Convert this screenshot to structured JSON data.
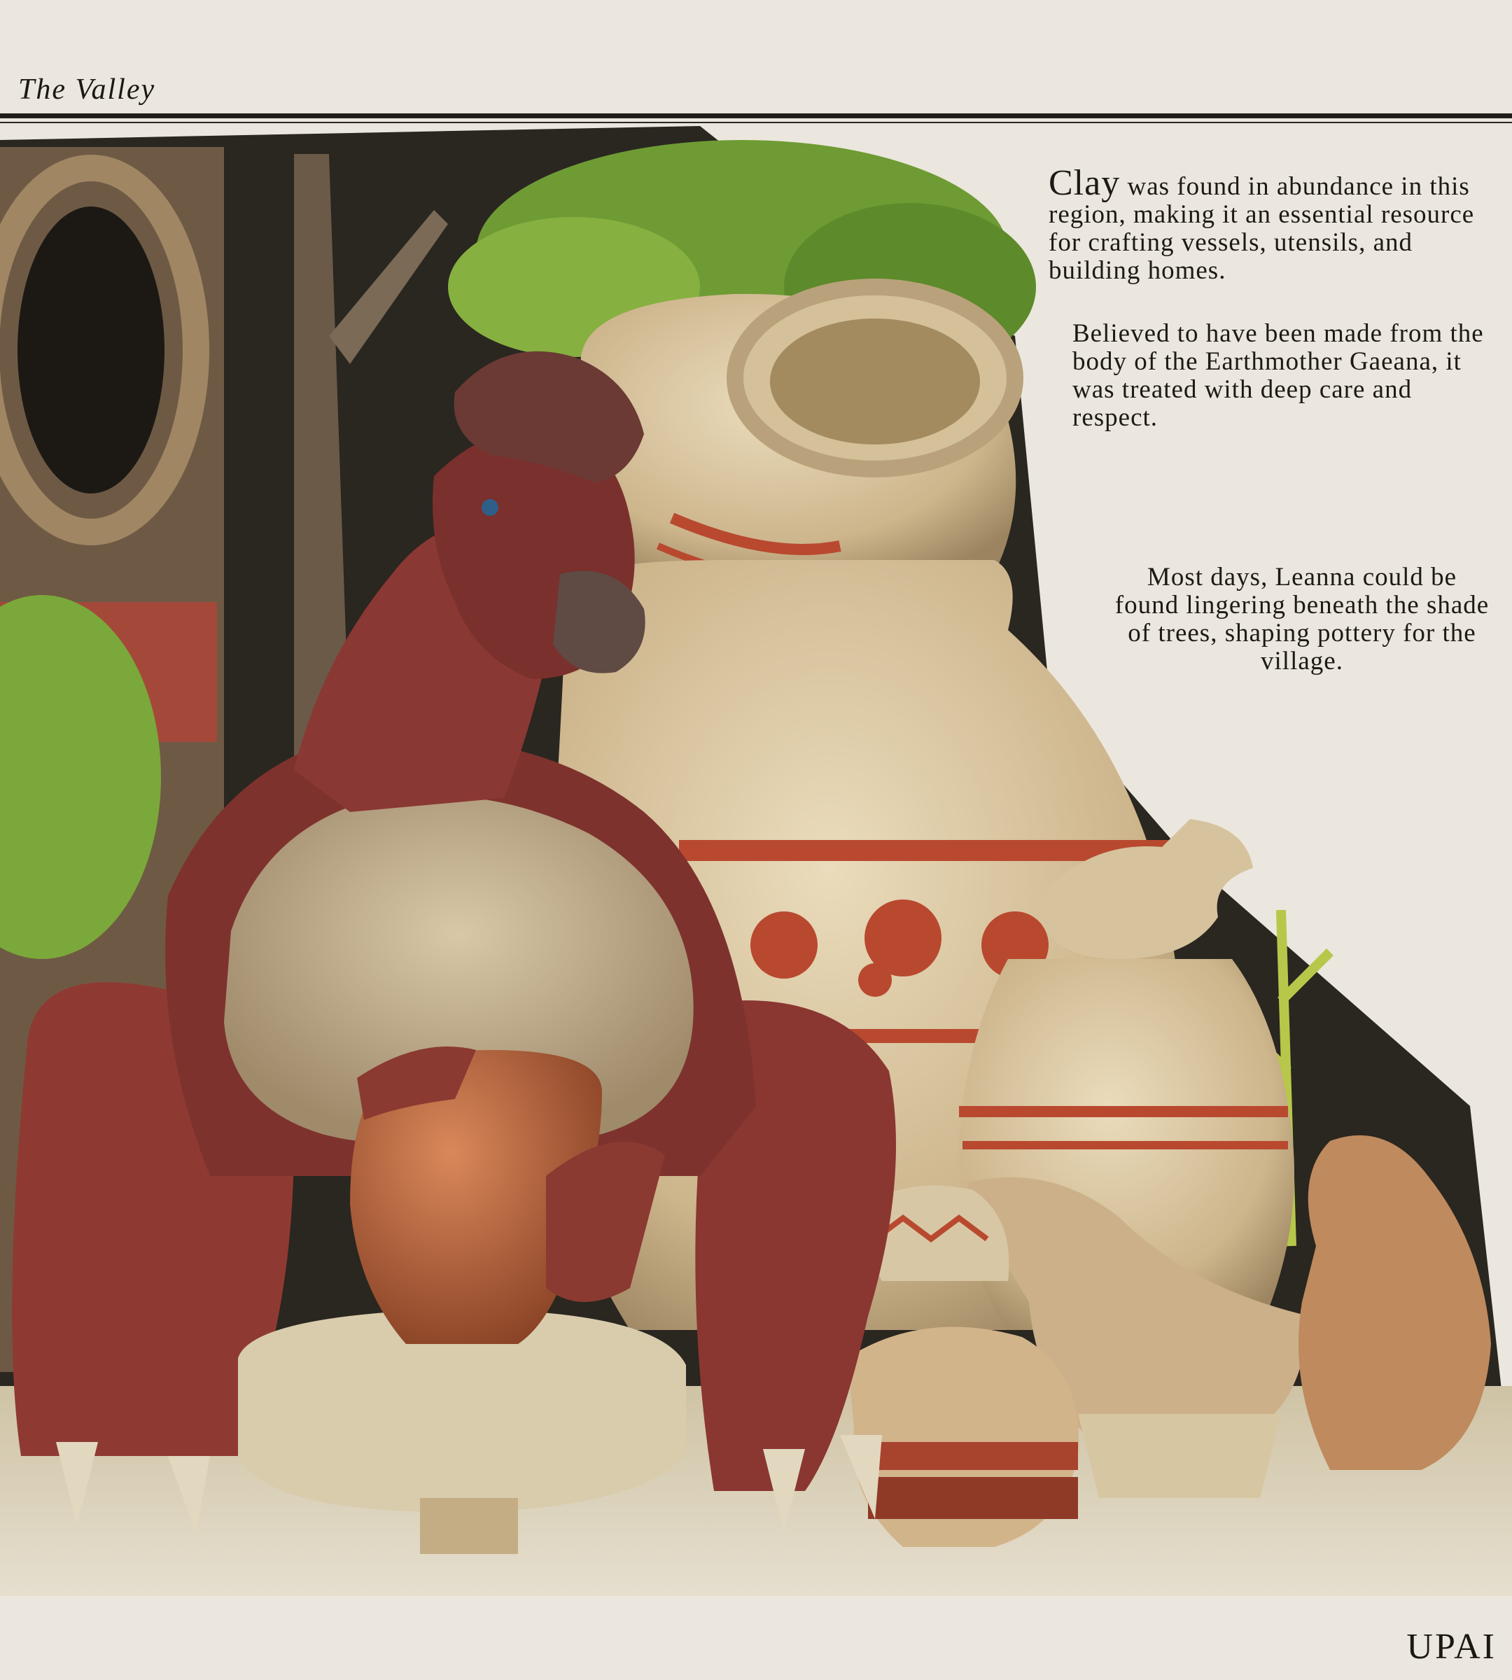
{
  "header": {
    "title": "The Valley"
  },
  "text": {
    "para1_lead": "Clay",
    "para1_rest": " was found in abundance in this region, making it an essential resource for crafting vessels, utensils, and building homes.",
    "para2": "Believed to have been made from the body of the Earthmother Gaeana, it was treated with deep care and respect.",
    "para3": "Most days, Leanna could be found lingering beneath the shade of trees, shaping pottery for the village."
  },
  "signature": "UPAI",
  "colors": {
    "paper": "#ebe7de",
    "clay_cream": "#d9c7a3",
    "terracotta": "#b8492f",
    "creature_red": "#8e3a33",
    "foliage_green": "#7aa33a",
    "shadow": "#1d1a16"
  }
}
